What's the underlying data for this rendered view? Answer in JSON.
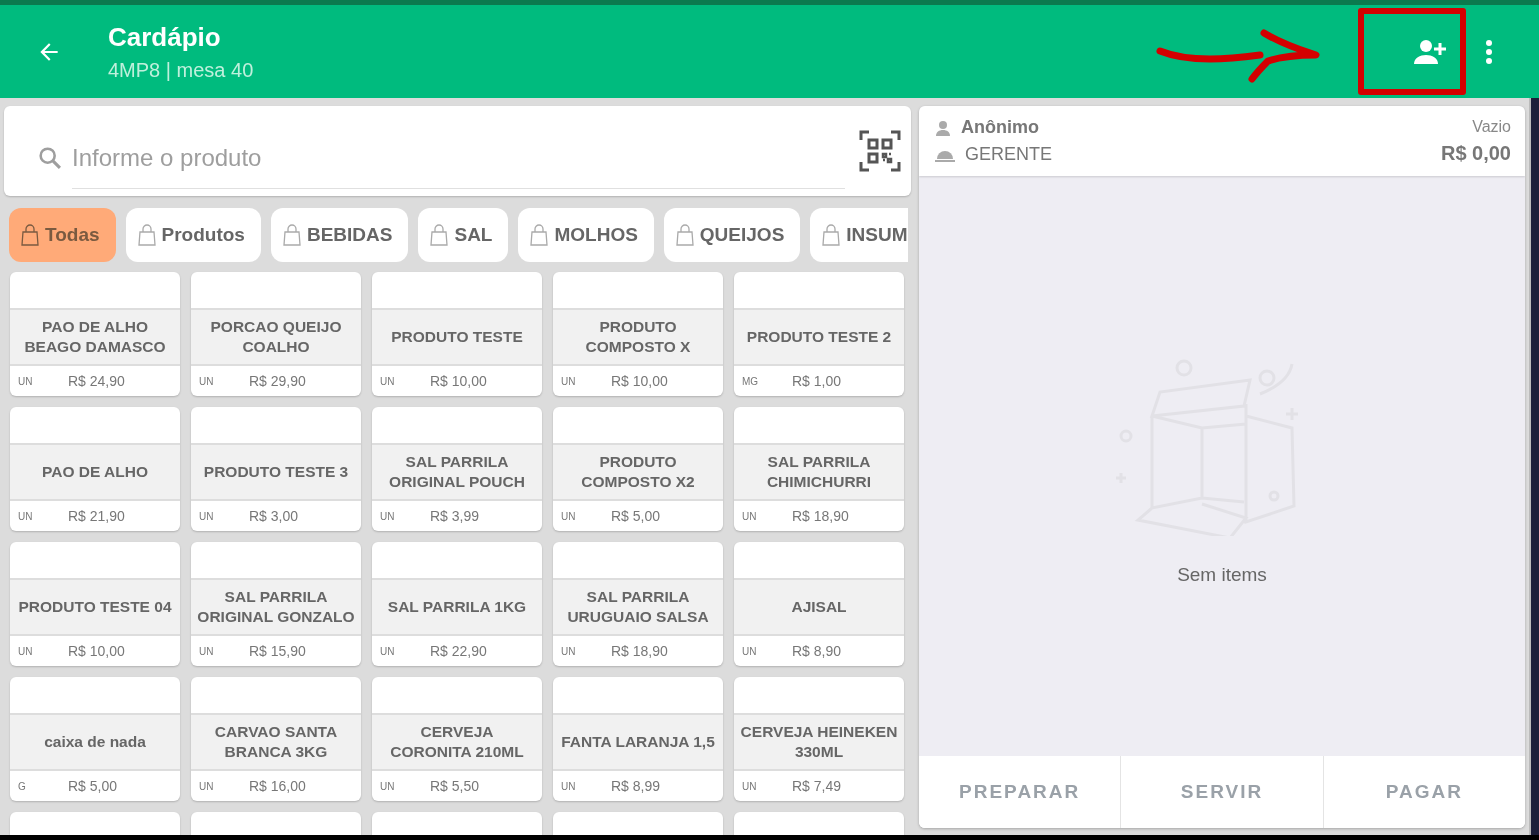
{
  "header": {
    "title": "Cardápio",
    "subtitle": "4MP8 | mesa 40"
  },
  "search": {
    "placeholder": "Informe o produto"
  },
  "categories": [
    {
      "label": "Todas",
      "selected": true
    },
    {
      "label": "Produtos",
      "selected": false
    },
    {
      "label": "BEBIDAS",
      "selected": false
    },
    {
      "label": "SAL",
      "selected": false
    },
    {
      "label": "MOLHOS",
      "selected": false
    },
    {
      "label": "QUEIJOS",
      "selected": false
    },
    {
      "label": "INSUM",
      "selected": false
    }
  ],
  "products": [
    {
      "kind": "product",
      "name": "PAO DE ALHO BEAGO DAMASCO",
      "unit": "UN",
      "price": "R$ 24,90"
    },
    {
      "kind": "product",
      "name": "PORCAO QUEIJO COALHO",
      "unit": "UN",
      "price": "R$ 29,90"
    },
    {
      "kind": "product",
      "name": "PRODUTO TESTE",
      "unit": "UN",
      "price": "R$ 10,00"
    },
    {
      "kind": "product",
      "name": "PRODUTO COMPOSTO X",
      "unit": "UN",
      "price": "R$ 10,00"
    },
    {
      "kind": "product",
      "name": "PRODUTO TESTE 2",
      "unit": "MG",
      "price": "R$ 1,00"
    },
    {
      "kind": "product",
      "name": "PAO DE ALHO",
      "unit": "UN",
      "price": "R$ 21,90"
    },
    {
      "kind": "product",
      "name": "PRODUTO TESTE 3",
      "unit": "UN",
      "price": "R$ 3,00"
    },
    {
      "kind": "product",
      "name": "SAL PARRILA ORIGINAL POUCH",
      "unit": "UN",
      "price": "R$ 3,99"
    },
    {
      "kind": "product",
      "name": "PRODUTO COMPOSTO X2",
      "unit": "UN",
      "price": "R$ 5,00"
    },
    {
      "kind": "product",
      "name": "SAL PARRILA CHIMICHURRI",
      "unit": "UN",
      "price": "R$ 18,90"
    },
    {
      "kind": "product",
      "name": "PRODUTO TESTE 04",
      "unit": "UN",
      "price": "R$ 10,00"
    },
    {
      "kind": "product",
      "name": "SAL PARRILA ORIGINAL GONZALO",
      "unit": "UN",
      "price": "R$ 15,90"
    },
    {
      "kind": "product",
      "name": "SAL PARRILA 1KG",
      "unit": "UN",
      "price": "R$ 22,90"
    },
    {
      "kind": "product",
      "name": "SAL PARRILA URUGUAIO SALSA",
      "unit": "UN",
      "price": "R$ 18,90"
    },
    {
      "kind": "product",
      "name": "AJISAL",
      "unit": "UN",
      "price": "R$ 8,90"
    },
    {
      "kind": "product",
      "name": "caixa de nada",
      "unit": "G",
      "price": "R$ 5,00"
    },
    {
      "kind": "product",
      "name": "CARVAO SANTA BRANCA 3KG",
      "unit": "UN",
      "price": "R$ 16,00"
    },
    {
      "kind": "product",
      "name": "CERVEJA CORONITA 210ML",
      "unit": "UN",
      "price": "R$ 5,50"
    },
    {
      "kind": "product",
      "name": "FANTA LARANJA 1,5",
      "unit": "UN",
      "price": "R$ 8,99"
    },
    {
      "kind": "product",
      "name": "CERVEJA HEINEKEN 330ML",
      "unit": "UN",
      "price": "R$ 7,49"
    },
    {
      "kind": "cut_off"
    },
    {
      "kind": "cut_off"
    },
    {
      "kind": "cut_off"
    },
    {
      "kind": "cut_off"
    },
    {
      "kind": "cut_off"
    }
  ],
  "order": {
    "customer": "Anônimo",
    "role": "GERENTE",
    "status": "Vazio",
    "total": "R$ 0,00",
    "empty_message": "Sem items",
    "actions": [
      {
        "label": "PREPARAR",
        "disabled": true
      },
      {
        "label": "SERVIR",
        "disabled": true
      },
      {
        "label": "PAGAR",
        "disabled": true
      }
    ]
  }
}
